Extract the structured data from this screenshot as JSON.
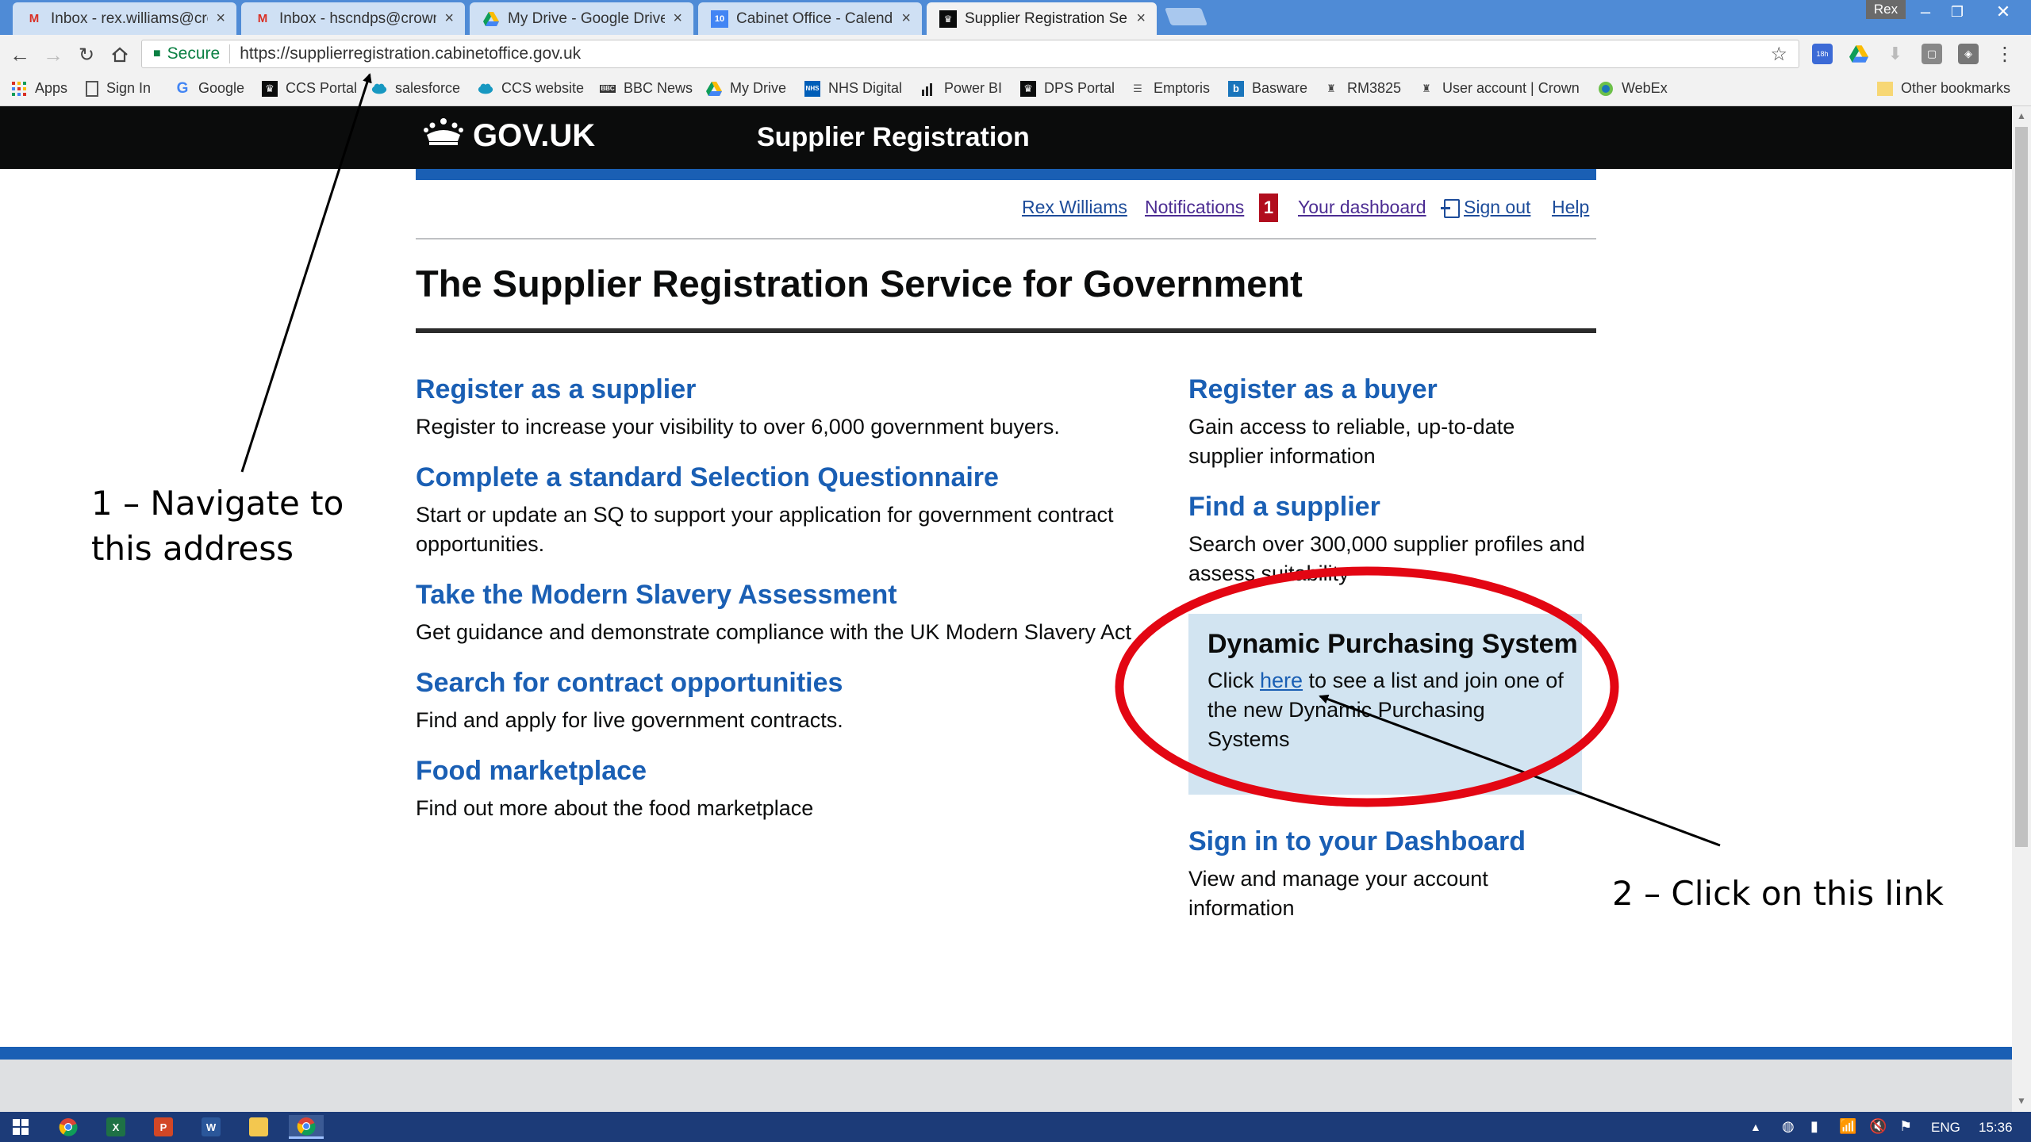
{
  "browser": {
    "tabs": [
      {
        "title": "Inbox - rex.williams@crown",
        "icon": "gmail-icon",
        "active": false
      },
      {
        "title": "Inbox - hscndps@crowncom",
        "icon": "gmail-icon",
        "active": false
      },
      {
        "title": "My Drive - Google Drive",
        "icon": "google-drive-icon",
        "active": false
      },
      {
        "title": "Cabinet Office - Calendar",
        "icon": "calendar-icon",
        "active": false
      },
      {
        "title": "Supplier Registration Serv",
        "icon": "crown-icon",
        "active": true
      }
    ],
    "user_chip": "Rex",
    "secure_label": "Secure",
    "url": "https://supplierregistration.cabinetoffice.gov.uk",
    "extension_badge": "18h",
    "bookmarks": [
      {
        "label": "Apps",
        "icon": "apps-grid-icon"
      },
      {
        "label": "Sign In",
        "icon": "page-icon"
      },
      {
        "label": "Google",
        "icon": "google-icon"
      },
      {
        "label": "CCS Portal",
        "icon": "crown-icon"
      },
      {
        "label": "salesforce",
        "icon": "salesforce-cloud-icon"
      },
      {
        "label": "CCS website",
        "icon": "salesforce-cloud-icon"
      },
      {
        "label": "BBC News",
        "icon": "bbc-icon"
      },
      {
        "label": "My Drive",
        "icon": "google-drive-icon"
      },
      {
        "label": "NHS Digital",
        "icon": "nhs-icon"
      },
      {
        "label": "Power BI",
        "icon": "power-bi-icon"
      },
      {
        "label": "DPS Portal",
        "icon": "crown-icon"
      },
      {
        "label": "Emptoris",
        "icon": "emptoris-icon"
      },
      {
        "label": "Basware",
        "icon": "basware-icon"
      },
      {
        "label": "RM3825",
        "icon": "crest-icon"
      },
      {
        "label": "User account | Crown",
        "icon": "crest-icon"
      },
      {
        "label": "WebEx",
        "icon": "webex-icon"
      }
    ],
    "other_bookmarks": "Other bookmarks"
  },
  "header": {
    "logo_text": "GOV.UK",
    "service_name": "Supplier Registration"
  },
  "user_nav": {
    "user_name": "Rex Williams",
    "notifications": "Notifications",
    "notification_count": "1",
    "dashboard": "Your dashboard",
    "sign_out": "Sign out",
    "help": "Help"
  },
  "page_title": "The Supplier Registration Service for Government",
  "left_sections": [
    {
      "link": "Register as a supplier",
      "desc": "Register to increase your visibility to over 6,000 government buyers."
    },
    {
      "link": "Complete a standard Selection Questionnaire",
      "desc": "Start or update an SQ to support your application for government contract opportunities."
    },
    {
      "link": "Take the Modern Slavery Assessment",
      "desc": "Get guidance and demonstrate compliance with the UK Modern Slavery Act"
    },
    {
      "link": "Search for contract opportunities",
      "desc": "Find and apply for live government contracts."
    },
    {
      "link": "Food marketplace",
      "desc": "Find out more about the food marketplace"
    }
  ],
  "right_sections": [
    {
      "link": "Register as a buyer",
      "desc": "Gain access to reliable, up-to-date supplier information"
    },
    {
      "link": "Find a supplier",
      "desc": "Search over 300,000 supplier profiles and assess suitability"
    },
    {
      "link": "Sign in to your Dashboard",
      "desc": "View and manage your account information"
    }
  ],
  "dps_panel": {
    "title": "Dynamic Purchasing System",
    "text_before": "Click ",
    "link": "here",
    "text_after": " to see a list and join one of the new Dynamic Purchasing Systems"
  },
  "annotations": {
    "step1": "1 – Navigate to this address",
    "step2": "2 – Click on this link",
    "highlight_color": "#e30613"
  },
  "taskbar": {
    "language": "ENG",
    "time": "15:36"
  },
  "colors": {
    "gov_black": "#0b0c0c",
    "link_blue": "#1a5fb4",
    "dps_panel_bg": "#d2e4f1",
    "notification_red": "#b10e1e",
    "tab_strip": "#4f8bd6"
  }
}
